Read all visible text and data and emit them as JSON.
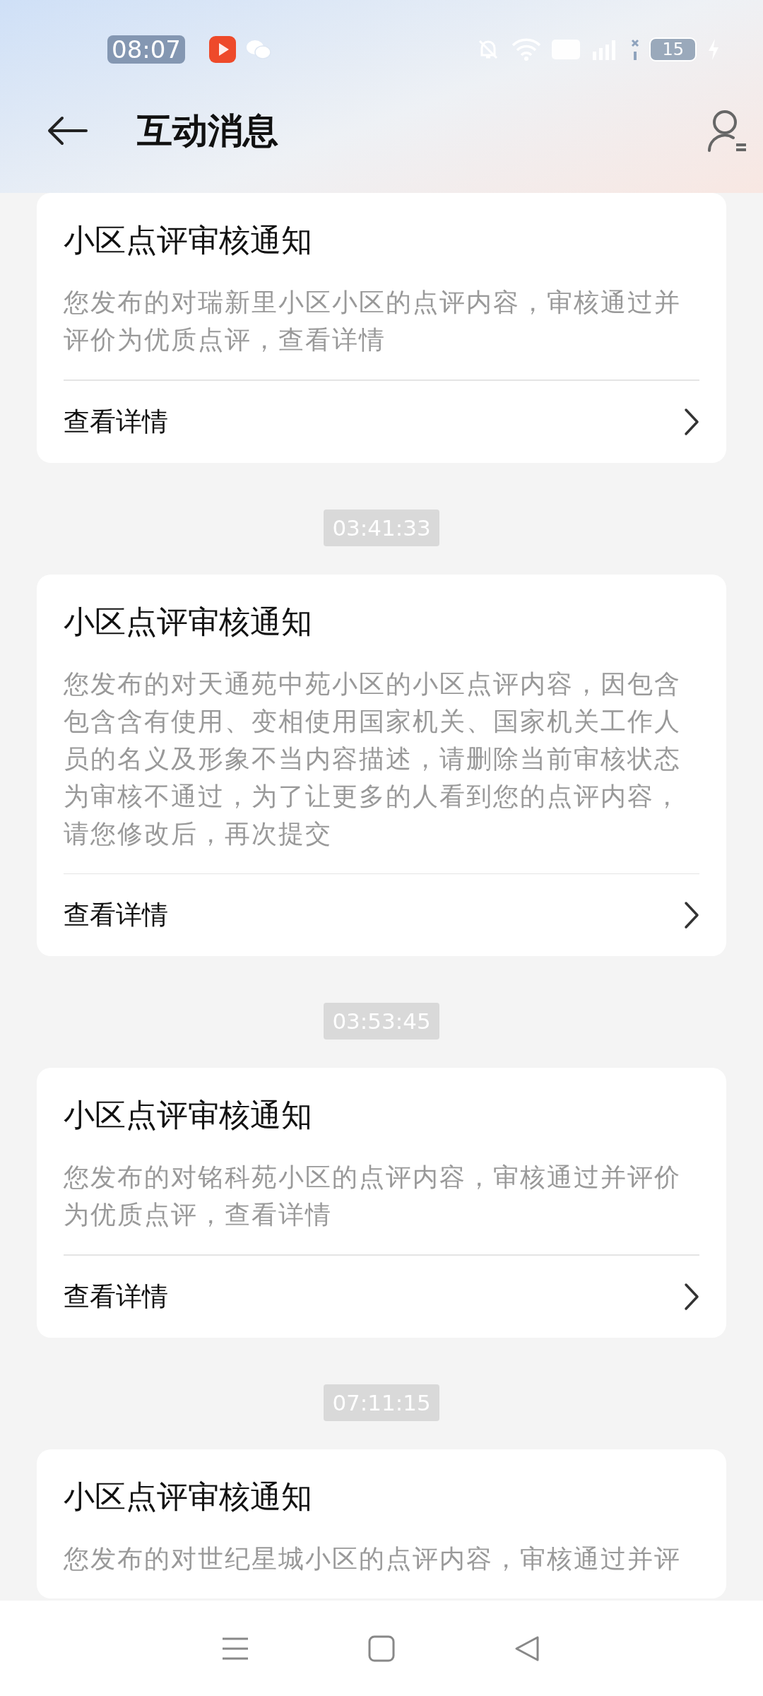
{
  "status_bar": {
    "time": "08:07",
    "battery": "15"
  },
  "header": {
    "title": "互动消息"
  },
  "messages": [
    {
      "title": "小区点评审核通知",
      "body": "您发布的对瑞新里小区小区的点评内容，审核通过并评价为优质点评，查看详情",
      "link": "查看详情"
    },
    {
      "timestamp": "03:41:33",
      "title": "小区点评审核通知",
      "body": "您发布的对天通苑中苑小区的小区点评内容，因包含包含含有使用、变相使用国家机关、国家机关工作人员的名义及形象不当内容描述，请删除当前审核状态为审核不通过，为了让更多的人看到您的点评内容，请您修改后，再次提交",
      "link": "查看详情"
    },
    {
      "timestamp": "03:53:45",
      "title": "小区点评审核通知",
      "body": "您发布的对铭科苑小区的点评内容，审核通过并评价为优质点评，查看详情",
      "link": "查看详情"
    },
    {
      "timestamp": "07:11:15",
      "title": "小区点评审核通知",
      "body": "您发布的对世纪星城小区的点评内容，审核通过并评"
    }
  ]
}
